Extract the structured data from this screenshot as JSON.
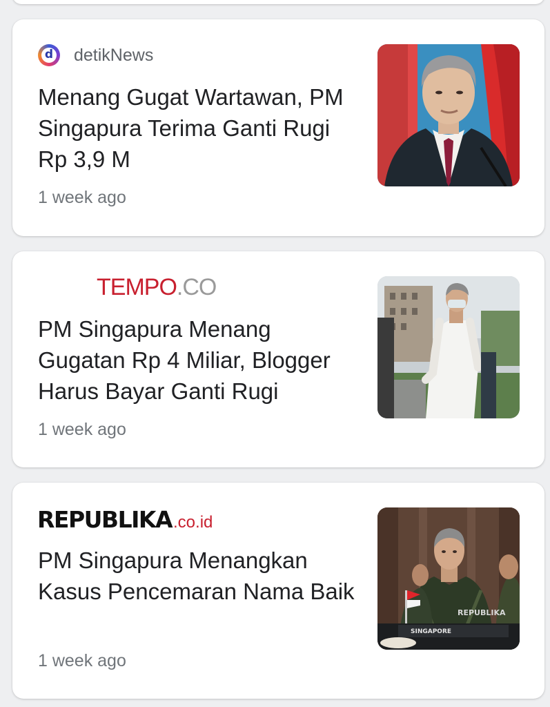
{
  "articles": [
    {
      "source": "detikNews",
      "source_icon": "detik-logo-icon",
      "headline": "Menang Gugat Wartawan, PM Singapura Terima Ganti Rugi Rp 3,9 M",
      "time": "1 week ago",
      "thumbnail": "man-in-suit-with-flags-photo"
    },
    {
      "source": "TEMPO.CO",
      "source_logo": {
        "primary": "TEMPO",
        "secondary": ".CO"
      },
      "headline": "PM Singapura Menang Gugatan Rp 4 Miliar, Blogger Harus Bayar Ganti Rugi",
      "time": "1 week ago",
      "thumbnail": "man-in-white-walking-photo"
    },
    {
      "source": "REPUBLIKA.co.id",
      "source_logo": {
        "primary": "REPUBLIKA",
        "secondary": ".co.id"
      },
      "headline": "PM Singapura Menangkan Kasus Pencemaran Nama Baik",
      "time": "1 week ago",
      "thumbnail": "man-at-conference-table-photo",
      "thumbnail_text": [
        "REPUBLIKA",
        "SINGAPORE"
      ]
    }
  ],
  "colors": {
    "background": "#eeeff1",
    "card": "#ffffff",
    "headline": "#202124",
    "meta": "#70757a",
    "tempo_red": "#c8202f",
    "republika_red": "#c8202f"
  }
}
